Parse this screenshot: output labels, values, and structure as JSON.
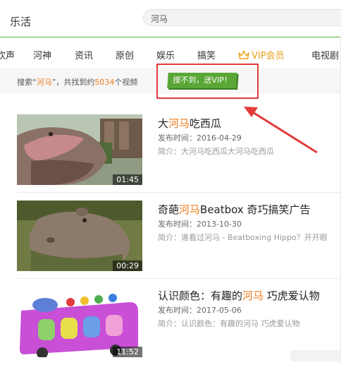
{
  "header": {
    "app_title": "乐活",
    "search_value": "河马"
  },
  "nav": {
    "items": [
      "欢声",
      "河神",
      "资讯",
      "原创",
      "娱乐",
      "搞笑",
      "VIP会员",
      "电视剧"
    ]
  },
  "info": {
    "prefix": "搜索“",
    "keyword": "河马",
    "middle": "”，共找到约",
    "count": "5034",
    "suffix": "个视频",
    "promo_label": "搜不到，送VIP！"
  },
  "videos": [
    {
      "title_pre": "大",
      "title_hl": "河马",
      "title_post": "吃西瓜",
      "date": "发布时间：2016-04-29",
      "desc": "简介：大河马吃西瓜大河马吃西瓜",
      "duration": "01:45"
    },
    {
      "title_pre": "奇葩",
      "title_hl": "河马",
      "title_post": "Beatbox 奇巧搞笑广告",
      "date": "发布时间：2013-10-30",
      "desc": "简介：谁看过河马 - Beatboxing Hippo？开开眼",
      "duration": "00:29"
    },
    {
      "title_pre": "认识颜色：有趣的",
      "title_hl": "河马",
      "title_post": " 巧虎爱认物",
      "date": "发布时间：2017-05-06",
      "desc": "简介：认识颜色：有趣的河马 巧虎爱认物",
      "duration": "11:52"
    }
  ],
  "colors": {
    "accent_green": "#5cb531",
    "highlight_orange": "#ee7b1c",
    "annotation_red": "#e23b3b",
    "vip_gold": "#e8a11c"
  }
}
